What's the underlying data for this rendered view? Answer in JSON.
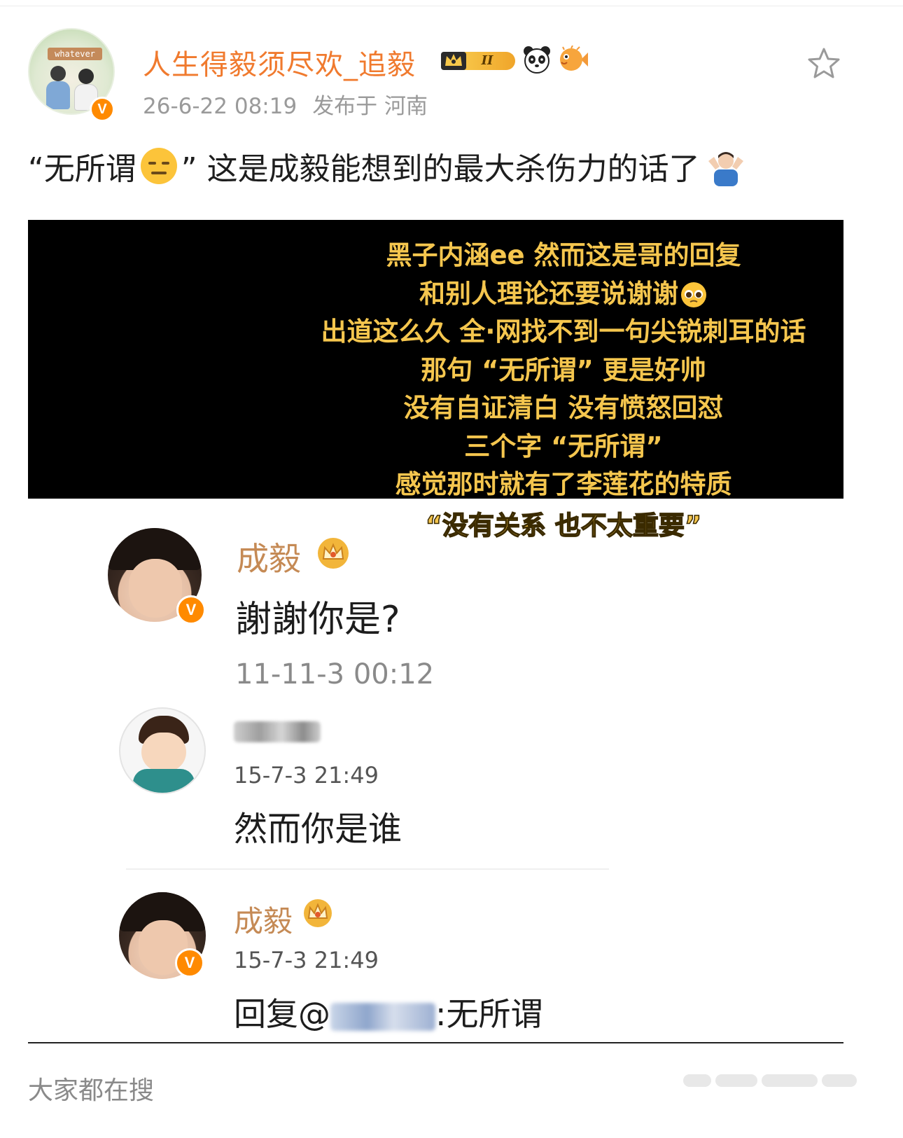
{
  "post": {
    "username": "人生得毅须尽欢_追毅",
    "level_badge": "II",
    "date": "26-6-22 08:19",
    "location": "发布于 河南",
    "text_part1": "“无所谓",
    "text_part2": "” 这是成毅能想到的最大杀伤力的话了",
    "avatar_sign": "whatever",
    "colors": {
      "username": "#f07a2e",
      "vip": "#ff8a00",
      "caption": "#f5c64e"
    }
  },
  "image": {
    "caption_lines": [
      "黑子内涵ee 然而这是哥的回复",
      "和别人理论还要说谢谢",
      "出道这么久 全·网找不到一句尖锐刺耳的话",
      "那句 “无所谓” 更是好帅",
      "没有自证清白 没有愤怒回怼",
      "三个字 “无所谓”",
      "感觉那时就有了李莲花的特质"
    ],
    "caption_last": "“没有关系 也不太重要”",
    "comments": [
      {
        "name": "成毅",
        "text": "謝謝你是?",
        "time": "11-11-3 00:12"
      },
      {
        "name": "",
        "time": "15-7-3 21:49",
        "text": "然而你是谁"
      },
      {
        "name": "成毅",
        "time": "15-7-3 21:49",
        "reply_prefix": "回复@",
        "reply_suffix": ":无所谓"
      }
    ]
  },
  "footer": {
    "label": "大家都在搜"
  },
  "icons": [
    "avatar",
    "v-badge-icon",
    "crown-icon",
    "panda-icon",
    "pufferfish-icon",
    "star-icon",
    "expressionless-emoji-icon",
    "shrug-emoji-icon",
    "pleading-emoji-icon"
  ]
}
